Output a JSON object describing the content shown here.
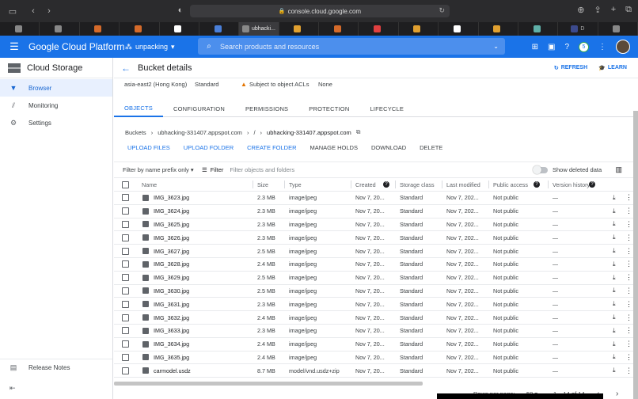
{
  "browser": {
    "url": "console.cloud.google.com",
    "tabs": [
      {
        "label": "",
        "active": false,
        "color": "#888"
      },
      {
        "label": "",
        "active": false,
        "color": "#888"
      },
      {
        "label": "",
        "active": false,
        "color": "#d46a2a"
      },
      {
        "label": "",
        "active": false,
        "color": "#d46a2a"
      },
      {
        "label": "",
        "active": false,
        "color": "#fff"
      },
      {
        "label": "",
        "active": false,
        "color": "#4a7fd8"
      },
      {
        "label": "ubhacki...",
        "active": true,
        "color": "#888"
      },
      {
        "label": "",
        "active": false,
        "color": "#e0a030"
      },
      {
        "label": "",
        "active": false,
        "color": "#d46a2a"
      },
      {
        "label": "",
        "active": false,
        "color": "#e04040"
      },
      {
        "label": "",
        "active": false,
        "color": "#e0a030"
      },
      {
        "label": "",
        "active": false,
        "color": "#fff"
      },
      {
        "label": "",
        "active": false,
        "color": "#e0a030"
      },
      {
        "label": "",
        "active": false,
        "color": "#5fb0a8"
      },
      {
        "label": "D",
        "active": false,
        "color": "#3c4a8c"
      },
      {
        "label": "",
        "active": false,
        "color": "#888"
      }
    ]
  },
  "header": {
    "title": "Google Cloud Platform",
    "project": "unpacking",
    "search_placeholder": "Search products and resources",
    "notification_count": "5"
  },
  "sidebar": {
    "title": "Cloud Storage",
    "items": [
      {
        "label": "Browser",
        "icon": "bucket-icon",
        "active": true
      },
      {
        "label": "Monitoring",
        "icon": "chart-icon",
        "active": false
      },
      {
        "label": "Settings",
        "icon": "gear-icon",
        "active": false
      }
    ],
    "release_notes": "Release Notes"
  },
  "page": {
    "title": "Bucket details",
    "refresh": "REFRESH",
    "learn": "LEARN",
    "info": {
      "location": "asia-east2 (Hong Kong)",
      "class": "Standard",
      "acl": "Subject to object ACLs",
      "protection": "None"
    },
    "tabs": [
      "OBJECTS",
      "CONFIGURATION",
      "PERMISSIONS",
      "PROTECTION",
      "LIFECYCLE"
    ],
    "breadcrumb": {
      "root": "Buckets",
      "bucket": "ubhacking-331407.appspot.com",
      "sep": "/",
      "folder": "ubhacking-331407.appspot.com"
    },
    "actions": [
      "UPLOAD FILES",
      "UPLOAD FOLDER",
      "CREATE FOLDER",
      "MANAGE HOLDS",
      "DOWNLOAD",
      "DELETE"
    ],
    "filter": {
      "prefix": "Filter by name prefix only",
      "label": "Filter",
      "placeholder": "Filter objects and folders",
      "deleted": "Show deleted data"
    }
  },
  "table": {
    "columns": [
      "Name",
      "Size",
      "Type",
      "Created",
      "Storage class",
      "Last modified",
      "Public access",
      "Version history"
    ],
    "rows": [
      [
        "IMG_3623.jpg",
        "2.3 MB",
        "image/jpeg",
        "Nov 7, 20...",
        "Standard",
        "Nov 7, 202...",
        "Not public",
        "—"
      ],
      [
        "IMG_3624.jpg",
        "2.3 MB",
        "image/jpeg",
        "Nov 7, 20...",
        "Standard",
        "Nov 7, 202...",
        "Not public",
        "—"
      ],
      [
        "IMG_3625.jpg",
        "2.3 MB",
        "image/jpeg",
        "Nov 7, 20...",
        "Standard",
        "Nov 7, 202...",
        "Not public",
        "—"
      ],
      [
        "IMG_3626.jpg",
        "2.3 MB",
        "image/jpeg",
        "Nov 7, 20...",
        "Standard",
        "Nov 7, 202...",
        "Not public",
        "—"
      ],
      [
        "IMG_3627.jpg",
        "2.5 MB",
        "image/jpeg",
        "Nov 7, 20...",
        "Standard",
        "Nov 7, 202...",
        "Not public",
        "—"
      ],
      [
        "IMG_3628.jpg",
        "2.4 MB",
        "image/jpeg",
        "Nov 7, 20...",
        "Standard",
        "Nov 7, 202...",
        "Not public",
        "—"
      ],
      [
        "IMG_3629.jpg",
        "2.5 MB",
        "image/jpeg",
        "Nov 7, 20...",
        "Standard",
        "Nov 7, 202...",
        "Not public",
        "—"
      ],
      [
        "IMG_3630.jpg",
        "2.5 MB",
        "image/jpeg",
        "Nov 7, 20...",
        "Standard",
        "Nov 7, 202...",
        "Not public",
        "—"
      ],
      [
        "IMG_3631.jpg",
        "2.3 MB",
        "image/jpeg",
        "Nov 7, 20...",
        "Standard",
        "Nov 7, 202...",
        "Not public",
        "—"
      ],
      [
        "IMG_3632.jpg",
        "2.4 MB",
        "image/jpeg",
        "Nov 7, 20...",
        "Standard",
        "Nov 7, 202...",
        "Not public",
        "—"
      ],
      [
        "IMG_3633.jpg",
        "2.3 MB",
        "image/jpeg",
        "Nov 7, 20...",
        "Standard",
        "Nov 7, 202...",
        "Not public",
        "—"
      ],
      [
        "IMG_3634.jpg",
        "2.4 MB",
        "image/jpeg",
        "Nov 7, 20...",
        "Standard",
        "Nov 7, 202...",
        "Not public",
        "—"
      ],
      [
        "IMG_3635.jpg",
        "2.4 MB",
        "image/jpeg",
        "Nov 7, 20...",
        "Standard",
        "Nov 7, 202...",
        "Not public",
        "—"
      ],
      [
        "carmodel.usdz",
        "8.7 MB",
        "model/vnd.usdz+zip",
        "Nov 7, 20...",
        "Standard",
        "Nov 7, 202...",
        "Not public",
        "—"
      ]
    ]
  },
  "pager": {
    "label": "Rows per page:",
    "value": "50",
    "range": "1 – 14 of 14"
  },
  "colors": {
    "brand": "#1a73e8",
    "sidebar_active": "#e8f0fe",
    "warning": "#e37400"
  }
}
